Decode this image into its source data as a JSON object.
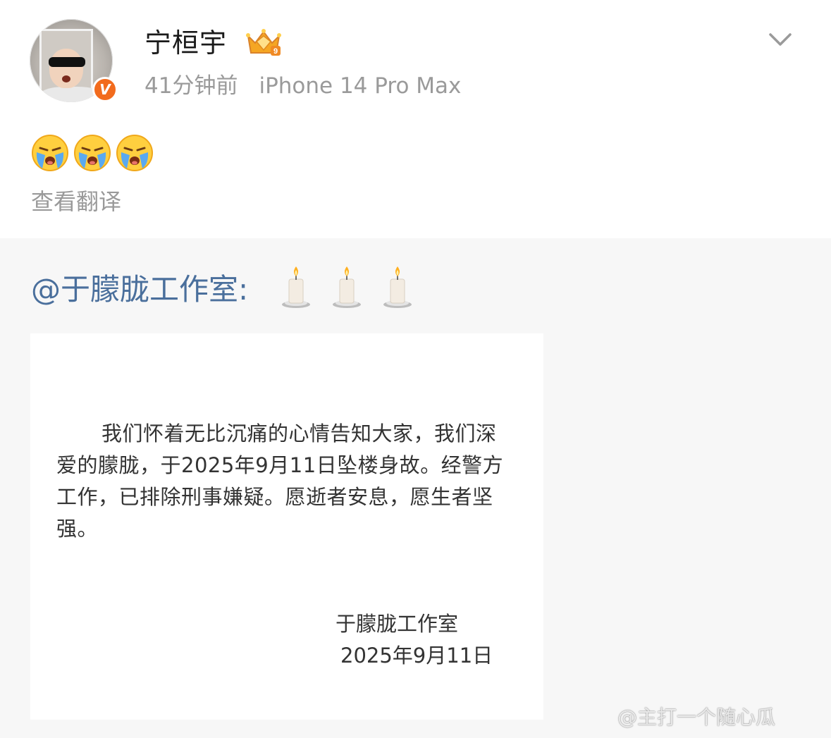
{
  "post": {
    "username": "宁桓宇",
    "verified_badge": "V",
    "time_ago": "41分钟前",
    "device": "iPhone 14 Pro Max",
    "emojis": [
      "crying-face-icon",
      "crying-face-icon",
      "crying-face-icon"
    ],
    "translate_label": "查看翻译",
    "menu_icon": "chevron-down-icon",
    "level_badge_icon": "crown-vip-icon"
  },
  "repost": {
    "mention": "@于朦胧工作室",
    "colon": ":",
    "candles": [
      "candle-icon",
      "candle-icon",
      "candle-icon"
    ],
    "notice_text": "我们怀着无比沉痛的心情告知大家，我们深爱的朦胧，于2025年9月11日坠楼身故。经警方工作，已排除刑事嫌疑。愿逝者安息，愿生者坚强。",
    "signature_name": "于朦胧工作室",
    "signature_date": "2025年9月11日",
    "watermark": "@主打一个随心瓜"
  },
  "colors": {
    "mention_blue": "#4a6f9c",
    "verified_orange": "#f26b1d",
    "meta_gray": "#9a9a9a",
    "repost_bg": "#f7f7f7"
  }
}
